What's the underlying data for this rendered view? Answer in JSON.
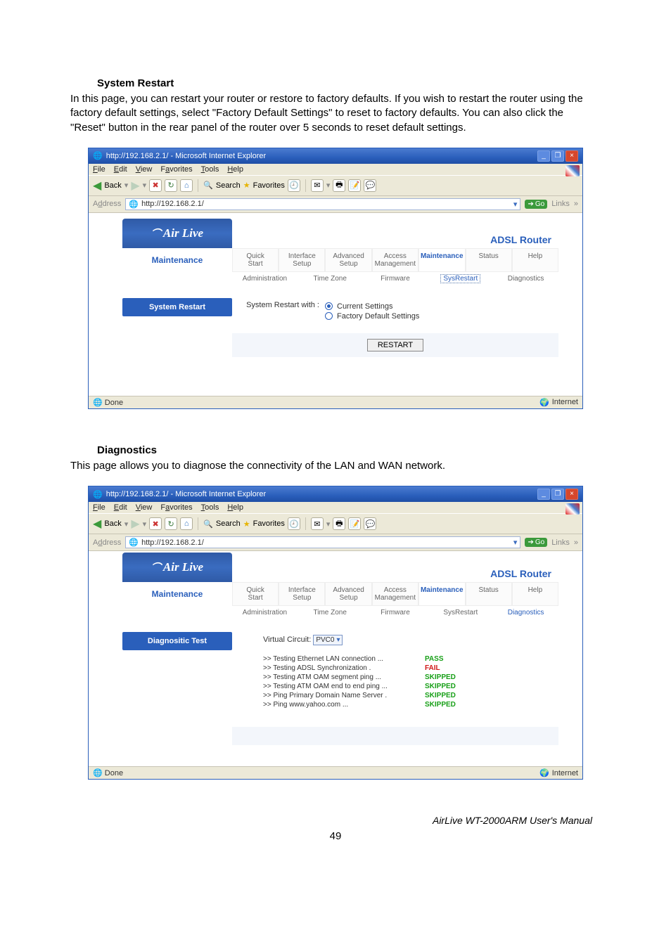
{
  "doc": {
    "section1_heading": "System Restart",
    "section1_para": "In this page, you can restart your router or restore to factory defaults. If you wish to restart the router using the factory default settings, select \"Factory Default Settings\" to reset to factory defaults. You can also click the \"Reset\" button in the rear panel of the router over 5 seconds to reset default settings.",
    "section2_heading": "Diagnostics",
    "section2_para": "This page allows you to diagnose the connectivity of the LAN and WAN network.",
    "footer": "AirLive WT-2000ARM User's Manual",
    "page_number": "49"
  },
  "ie": {
    "title": "http://192.168.2.1/ - Microsoft Internet Explorer",
    "menus": [
      "File",
      "Edit",
      "View",
      "Favorites",
      "Tools",
      "Help"
    ],
    "back": "Back",
    "search": "Search",
    "favorites": "Favorites",
    "address_label": "Address",
    "address_value": "http://192.168.2.1/",
    "go": "Go",
    "links": "Links",
    "status_done": "Done",
    "status_zone": "Internet"
  },
  "router": {
    "logo": "Air Live",
    "product": "ADSL Router",
    "sidebar": "Maintenance",
    "top_tabs": [
      {
        "l1": "Quick",
        "l2": "Start"
      },
      {
        "l1": "Interface",
        "l2": "Setup"
      },
      {
        "l1": "Advanced",
        "l2": "Setup"
      },
      {
        "l1": "Access",
        "l2": "Management"
      },
      {
        "l1": "Maintenance",
        "l2": ""
      },
      {
        "l1": "Status",
        "l2": ""
      },
      {
        "l1": "Help",
        "l2": ""
      }
    ],
    "sub_tabs": [
      "Administration",
      "Time Zone",
      "Firmware",
      "SysRestart",
      "Diagnostics"
    ]
  },
  "restart": {
    "side_label": "System Restart",
    "prompt": "System Restart with :",
    "opt_current": "Current Settings",
    "opt_factory": "Factory Default Settings",
    "button": "RESTART"
  },
  "diag": {
    "side_label": "Diagnositic Test",
    "vc_label": "Virtual Circuit:",
    "vc_value": "PVC0",
    "tests": [
      {
        "label": ">> Testing Ethernet LAN connection ...",
        "result": "PASS",
        "cls": "pass"
      },
      {
        "label": ">> Testing ADSL Synchronization .",
        "result": "FAIL",
        "cls": "fail"
      },
      {
        "label": ">> Testing ATM OAM segment ping ...",
        "result": "SKIPPED",
        "cls": "skip"
      },
      {
        "label": ">> Testing ATM OAM end to end ping ...",
        "result": "SKIPPED",
        "cls": "skip"
      },
      {
        "label": ">> Ping Primary Domain Name Server .",
        "result": "SKIPPED",
        "cls": "skip"
      },
      {
        "label": ">> Ping www.yahoo.com ...",
        "result": "SKIPPED",
        "cls": "skip"
      }
    ]
  }
}
